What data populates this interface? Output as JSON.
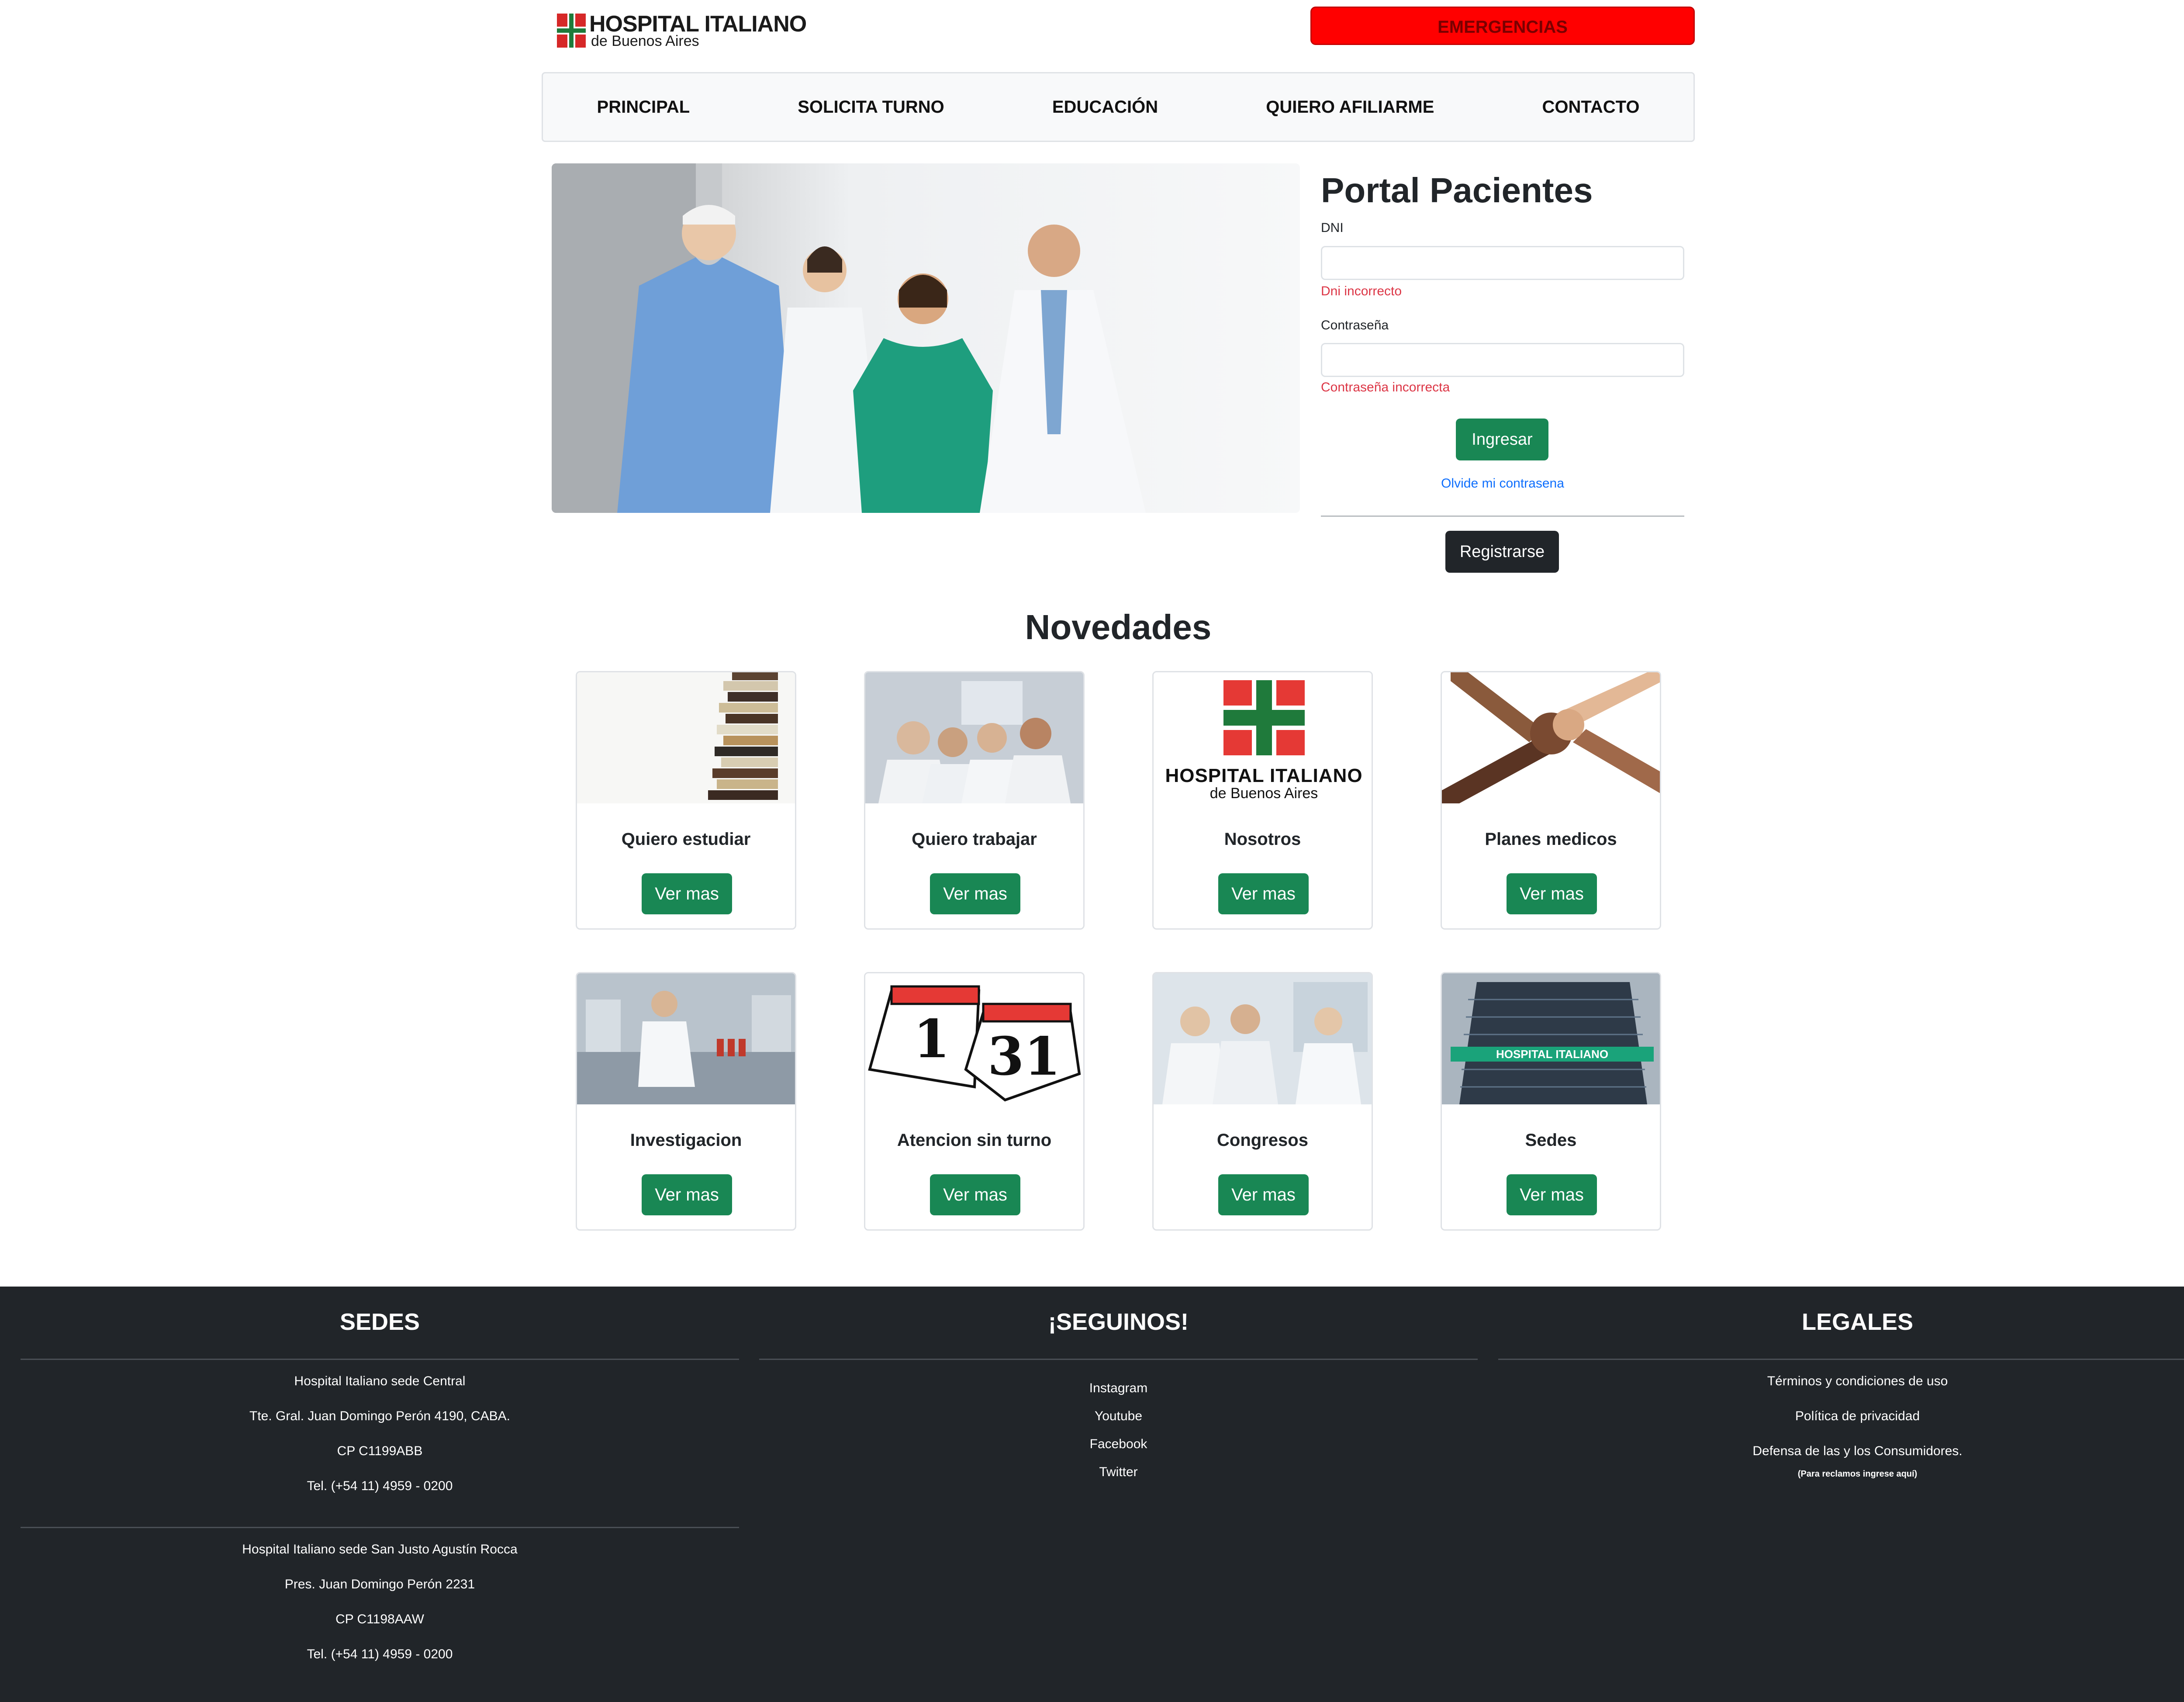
{
  "header": {
    "logo_line1": "HOSPITAL ITALIANO",
    "logo_line2": "de Buenos Aires",
    "emergency_label": "EMERGENCIAS"
  },
  "nav": {
    "items": [
      "PRINCIPAL",
      "SOLICITA TURNO",
      "EDUCACIÓN",
      "QUIERO AFILIARME",
      "CONTACTO"
    ]
  },
  "login": {
    "title": "Portal Pacientes",
    "dni_label": "DNI",
    "dni_value": "",
    "dni_error": "Dni incorrecto",
    "password_label": "Contraseña",
    "password_value": "",
    "password_error": "Contraseña incorrecta",
    "submit_label": "Ingresar",
    "forgot_label": "Olvide mi contrasena",
    "register_label": "Registrarse"
  },
  "novedades": {
    "title": "Novedades",
    "button_label": "Ver mas",
    "cards": [
      {
        "title": "Quiero estudiar",
        "image": "books-image"
      },
      {
        "title": "Quiero trabajar",
        "image": "doctors-xray-image"
      },
      {
        "title": "Nosotros",
        "image": "hospital-logo-image",
        "logo_line1": "HOSPITAL ITALIANO",
        "logo_line2": "de Buenos Aires"
      },
      {
        "title": "Planes medicos",
        "image": "joined-hands-image"
      },
      {
        "title": "Investigacion",
        "image": "laboratory-image"
      },
      {
        "title": "Atencion sin turno",
        "image": "calendar-image",
        "cal_left": "1",
        "cal_right": "31"
      },
      {
        "title": "Congresos",
        "image": "congress-doctors-image"
      },
      {
        "title": "Sedes",
        "image": "hospital-building-image",
        "sign": "HOSPITAL ITALIANO"
      }
    ]
  },
  "footer": {
    "sedes": {
      "title": "SEDES",
      "central": [
        "Hospital Italiano sede Central",
        "Tte. Gral. Juan Domingo Perón 4190, CABA.",
        "CP C1199ABB",
        "Tel. (+54 11) 4959 - 0200"
      ],
      "san_justo": [
        "Hospital Italiano sede San Justo Agustín Rocca",
        "Pres. Juan Domingo Perón 2231",
        "CP C1198AAW",
        "Tel. (+54 11) 4959 - 0200"
      ]
    },
    "social": {
      "title": "¡SEGUINOS!",
      "links": [
        "Instagram",
        "Youtube",
        "Facebook",
        "Twitter"
      ]
    },
    "legales": {
      "title": "LEGALES",
      "links": [
        "Términos y condiciones de uso",
        "Política de privacidad",
        "Defensa de las y los Consumidores."
      ],
      "note": "(Para reclamos ingrese aquí)"
    }
  }
}
